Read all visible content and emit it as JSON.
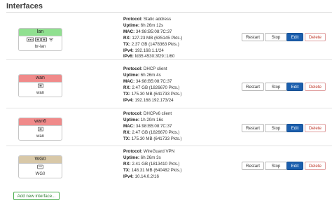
{
  "section_title": "Interfaces",
  "buttons": {
    "restart": "Restart",
    "stop": "Stop",
    "edit": "Edit",
    "delete": "Delete"
  },
  "add_button": "Add new interface...",
  "interfaces": [
    {
      "name": "lan",
      "device": "br-lan",
      "header_color": "#90e090",
      "device_icons": [
        "network-switch-icon",
        "ethernet-port-icon",
        "ethernet-port-icon",
        "wifi-icon"
      ],
      "lines": [
        {
          "k": "Protocol:",
          "v": "Static address"
        },
        {
          "k": "Uptime:",
          "v": "6h 26m 12s"
        },
        {
          "k": "MAC:",
          "v": "34:98:B5:08:7C:37"
        },
        {
          "k": "RX:",
          "v": "127.23 MB (635145 Pkts.)"
        },
        {
          "k": "TX:",
          "v": "2.37 GB (1478363 Pkts.)"
        },
        {
          "k": "IPv4:",
          "v": "192.168.1.1/24"
        },
        {
          "k": "IPv6:",
          "v": "fd35:4530:3f29::1/60"
        }
      ]
    },
    {
      "name": "wan",
      "device": "wan",
      "header_color": "#f08a8a",
      "device_icons": [
        "ethernet-port-icon"
      ],
      "lines": [
        {
          "k": "Protocol:",
          "v": "DHCP client"
        },
        {
          "k": "Uptime:",
          "v": "6h 26m 4s"
        },
        {
          "k": "MAC:",
          "v": "34:98:B5:08:7C:37"
        },
        {
          "k": "RX:",
          "v": "2.47 GB (1826670 Pkts.)"
        },
        {
          "k": "TX:",
          "v": "175.30 MB (641733 Pkts.)"
        },
        {
          "k": "IPv4:",
          "v": "192.168.192.173/24"
        }
      ]
    },
    {
      "name": "wan6",
      "device": "wan",
      "header_color": "#f08a8a",
      "device_icons": [
        "ethernet-port-icon"
      ],
      "lines": [
        {
          "k": "Protocol:",
          "v": "DHCPv6 client"
        },
        {
          "k": "Uptime:",
          "v": "1h 20m 16s"
        },
        {
          "k": "MAC:",
          "v": "34:98:B5:08:7C:37"
        },
        {
          "k": "RX:",
          "v": "2.47 GB (1826670 Pkts.)"
        },
        {
          "k": "TX:",
          "v": "175.30 MB (641733 Pkts.)"
        }
      ]
    },
    {
      "name": "WG0",
      "device": "WG0",
      "header_color": "#d8c8a8",
      "device_icons": [
        "tunnel-icon"
      ],
      "lines": [
        {
          "k": "Protocol:",
          "v": "WireGuard VPN"
        },
        {
          "k": "Uptime:",
          "v": "6h 26m 3s"
        },
        {
          "k": "RX:",
          "v": "2.41 GB (1813410 Pkts.)"
        },
        {
          "k": "TX:",
          "v": "148.31 MB (640482 Pkts.)"
        },
        {
          "k": "IPv4:",
          "v": "10.14.0.2/16"
        }
      ]
    }
  ]
}
